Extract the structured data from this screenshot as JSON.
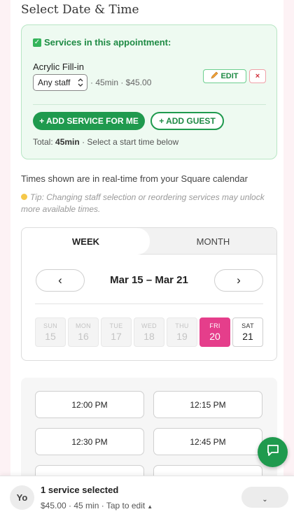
{
  "page": {
    "heading": "Select Date & Time"
  },
  "services_card": {
    "header": "Services in this appointment:",
    "service": {
      "name": "Acrylic Fill-in",
      "staff_selected": "Any staff",
      "meta": "· 45min · $45.00",
      "edit_label": "EDIT",
      "remove_label": "×"
    },
    "add_service_label": "+ ADD SERVICE FOR ME",
    "add_guest_label": "+ ADD GUEST",
    "total_prefix": "Total:",
    "total_duration": "45min",
    "total_suffix": "· Select a start time below"
  },
  "realtime_note": "Times shown are in real-time from your Square calendar",
  "tip": "Tip: Changing staff selection or reordering services may unlock more available times.",
  "calendar": {
    "tabs": {
      "week": "WEEK",
      "month": "MONTH"
    },
    "active_tab": "week",
    "prev_label": "‹",
    "next_label": "›",
    "range": "Mar 15 – Mar 21",
    "days": [
      {
        "name": "SUN",
        "date": "15",
        "state": "disabled"
      },
      {
        "name": "MON",
        "date": "16",
        "state": "disabled"
      },
      {
        "name": "TUE",
        "date": "17",
        "state": "disabled"
      },
      {
        "name": "WED",
        "date": "18",
        "state": "disabled"
      },
      {
        "name": "THU",
        "date": "19",
        "state": "disabled"
      },
      {
        "name": "FRI",
        "date": "20",
        "state": "selected"
      },
      {
        "name": "SAT",
        "date": "21",
        "state": "available"
      }
    ]
  },
  "time_slots": [
    "12:00 PM",
    "12:15 PM",
    "12:30 PM",
    "12:45 PM",
    "",
    ""
  ],
  "bottom_bar": {
    "avatar_initials": "Yo",
    "title": "1 service selected",
    "subtitle": "$45.00 · 45 min · Tap to edit",
    "subtitle_caret": "▲",
    "expand_label": "⌄"
  },
  "colors": {
    "brand_green": "#1f9a4e",
    "selected_day": "#e53e8b",
    "card_bg": "#eefaf1"
  },
  "icons": {
    "check": "check-icon",
    "edit": "pencil-icon",
    "tip": "lightbulb-icon",
    "chat": "chat-bubble-icon"
  }
}
